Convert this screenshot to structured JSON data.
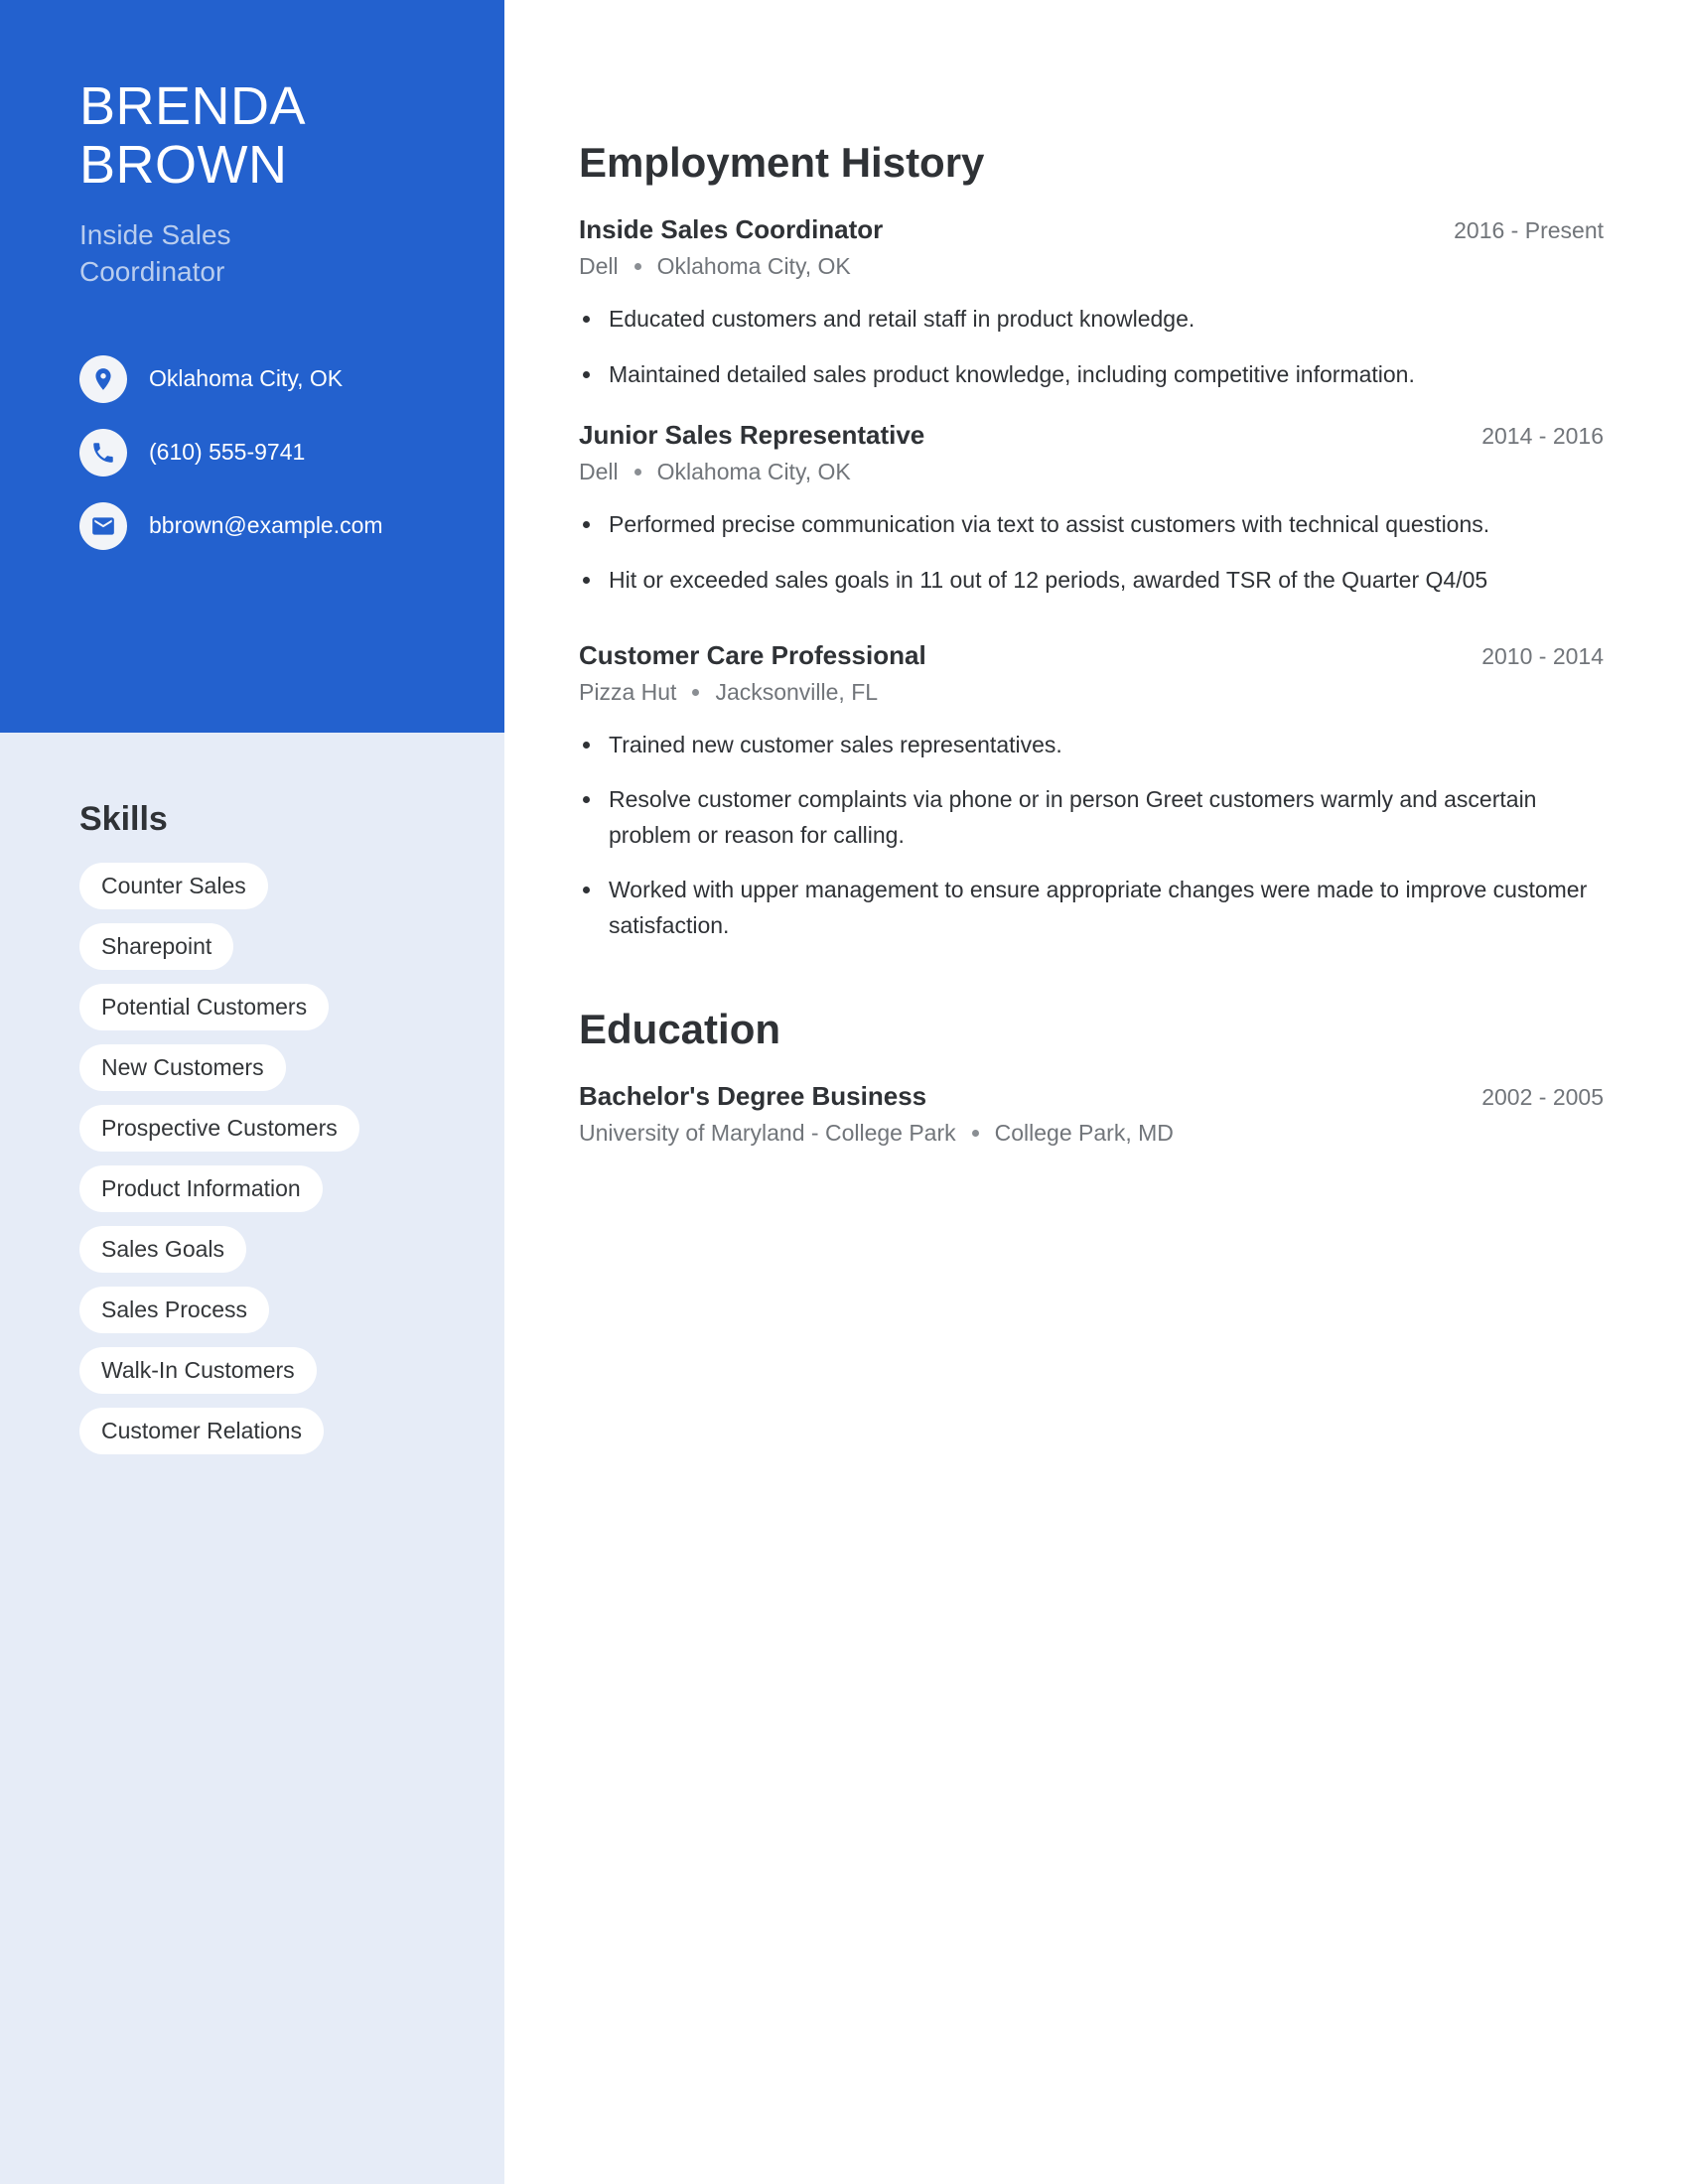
{
  "theme": {
    "sidebar_accent": "#2361ce",
    "sidebar_bg": "#e6ecf7",
    "pill_bg": "#ffffff",
    "text_dark": "#2f3236",
    "text_muted": "#71757a",
    "subtitle_light": "#b9cdee"
  },
  "profile": {
    "first_name": "BRENDA",
    "last_name": "BROWN",
    "job_title": "Inside Sales Coordinator"
  },
  "contacts": [
    {
      "icon": "location-pin-icon",
      "text": "Oklahoma City, OK"
    },
    {
      "icon": "phone-icon",
      "text": "(610) 555-9741"
    },
    {
      "icon": "email-icon",
      "text": "bbrown@example.com"
    }
  ],
  "skills": {
    "heading": "Skills",
    "items": [
      "Counter Sales",
      "Sharepoint",
      "Potential Customers",
      "New Customers",
      "Prospective Customers",
      "Product Information",
      "Sales Goals",
      "Sales Process",
      "Walk-In Customers",
      "Customer Relations"
    ]
  },
  "employment": {
    "heading": "Employment History",
    "entries": [
      {
        "title": "Inside Sales Coordinator",
        "date": "2016 - Present",
        "company": "Dell",
        "location": "Oklahoma City, OK",
        "bullets": [
          "Educated customers and retail staff in product knowledge.",
          "Maintained detailed sales product knowledge, including competitive information."
        ]
      },
      {
        "title": "Junior Sales Representative",
        "date": "2014 - 2016",
        "company": "Dell",
        "location": "Oklahoma City, OK",
        "bullets": [
          "Performed precise communication via text to assist customers with technical questions.",
          "Hit or exceeded sales goals in 11 out of 12 periods, awarded TSR of the Quarter Q4/05"
        ]
      },
      {
        "title": "Customer Care Professional",
        "date": "2010 - 2014",
        "company": "Pizza Hut",
        "location": "Jacksonville, FL",
        "bullets": [
          "Trained new customer sales representatives.",
          "Resolve customer complaints via phone or in person Greet customers warmly and ascertain problem or reason for calling.",
          "Worked with upper management to ensure appropriate changes were made to improve customer satisfaction."
        ]
      }
    ]
  },
  "education": {
    "heading": "Education",
    "entries": [
      {
        "title": "Bachelor's Degree Business",
        "date": "2002 - 2005",
        "school": "University of Maryland - College Park",
        "location": "College Park, MD"
      }
    ]
  }
}
